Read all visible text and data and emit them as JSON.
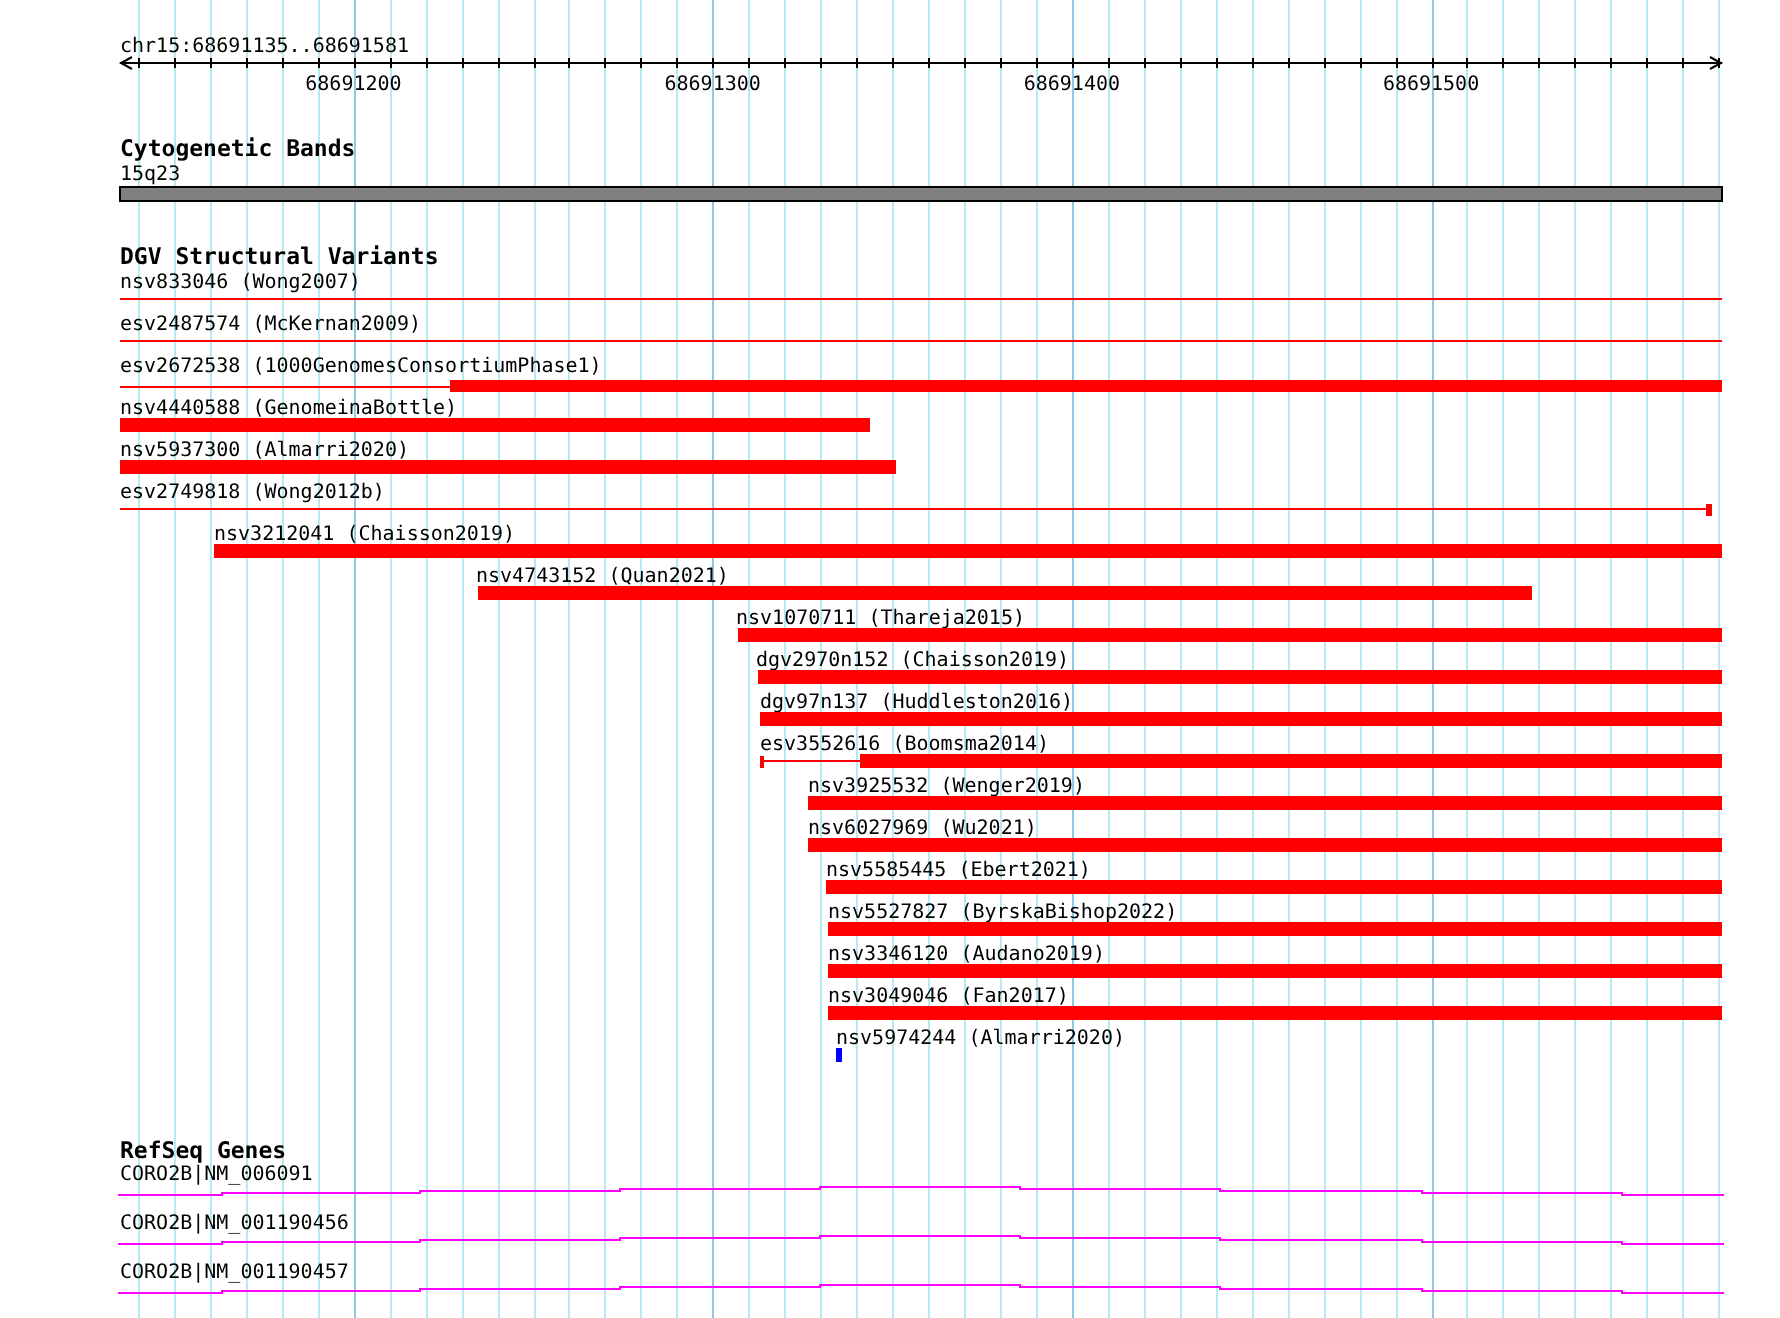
{
  "ruler": {
    "location": "chr15:68691135..68691581",
    "ticks": [
      "68691200",
      "68691300",
      "68691400",
      "68691500"
    ]
  },
  "cytobands": {
    "title": "Cytogenetic Bands",
    "band": "15q23"
  },
  "dgv": {
    "title": "DGV Structural Variants",
    "variants": [
      {
        "label": "nsv833046 (Wong2007)",
        "kind": "line",
        "color": "#ff0000"
      },
      {
        "label": "esv2487574 (McKernan2009)",
        "kind": "line",
        "color": "#ff0000"
      },
      {
        "label": "esv2672538 (1000GenomesConsortiumPhase1)",
        "kind": "line-bar",
        "color": "#ff0000"
      },
      {
        "label": "nsv4440588 (GenomeinaBottle)",
        "kind": "bar",
        "color": "#ff0000"
      },
      {
        "label": "nsv5937300 (Almarri2020)",
        "kind": "bar",
        "color": "#ff0000"
      },
      {
        "label": "esv2749818 (Wong2012b)",
        "kind": "capped-line",
        "color": "#ff0000"
      },
      {
        "label": "nsv3212041 (Chaisson2019)",
        "kind": "bar",
        "color": "#ff0000"
      },
      {
        "label": "nsv4743152 (Quan2021)",
        "kind": "bar",
        "color": "#ff0000"
      },
      {
        "label": "nsv1070711 (Thareja2015)",
        "kind": "bar",
        "color": "#ff0000"
      },
      {
        "label": "dgv2970n152 (Chaisson2019)",
        "kind": "bar",
        "color": "#ff0000"
      },
      {
        "label": "dgv97n137 (Huddleston2016)",
        "kind": "bar",
        "color": "#ff0000"
      },
      {
        "label": "esv3552616 (Boomsma2014)",
        "kind": "capped-line-bar",
        "color": "#ff0000"
      },
      {
        "label": "nsv3925532 (Wenger2019)",
        "kind": "bar",
        "color": "#ff0000"
      },
      {
        "label": "nsv6027969 (Wu2021)",
        "kind": "bar",
        "color": "#ff0000"
      },
      {
        "label": "nsv5585445 (Ebert2021)",
        "kind": "bar",
        "color": "#ff0000"
      },
      {
        "label": "nsv5527827 (ByrskaBishop2022)",
        "kind": "bar",
        "color": "#ff0000"
      },
      {
        "label": "nsv3346120 (Audano2019)",
        "kind": "bar",
        "color": "#ff0000"
      },
      {
        "label": "nsv3049046 (Fan2017)",
        "kind": "bar",
        "color": "#ff0000"
      },
      {
        "label": "nsv5974244 (Almarri2020)",
        "kind": "bar",
        "color": "#0000ff"
      }
    ]
  },
  "refseq": {
    "title": "RefSeq Genes",
    "transcripts": [
      {
        "label": "CORO2B|NM_006091"
      },
      {
        "label": "CORO2B|NM_001190456"
      },
      {
        "label": "CORO2B|NM_001190457"
      }
    ]
  }
}
